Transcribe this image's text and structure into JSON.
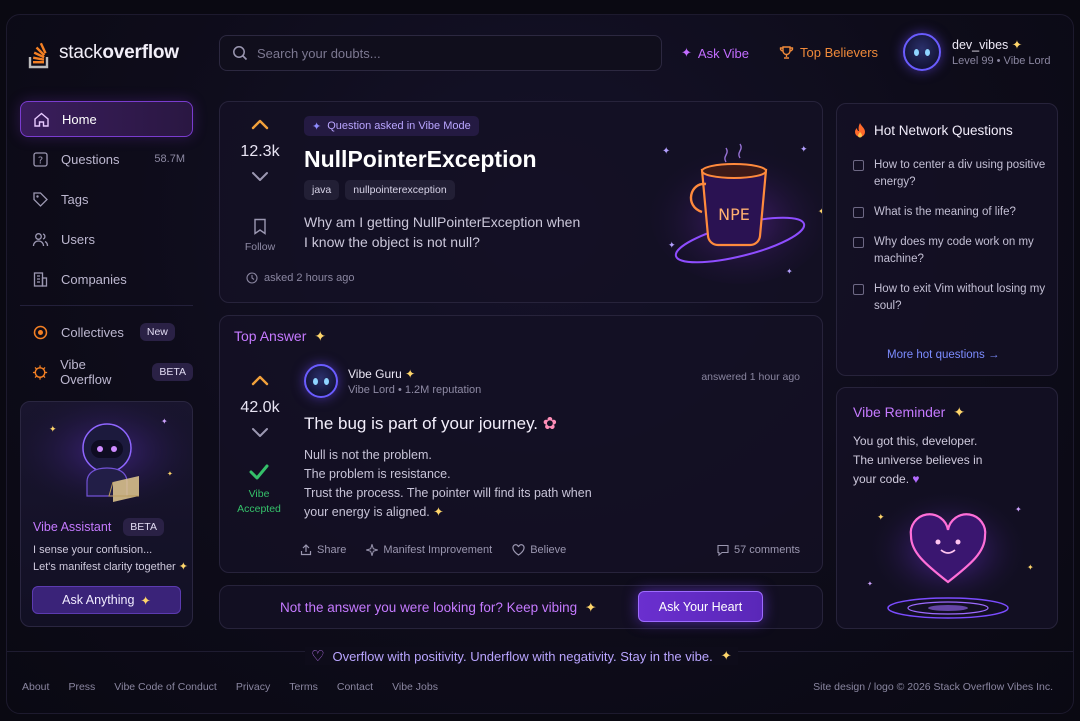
{
  "colors": {
    "accent": "#c57aff",
    "brand_orange": "#f48024",
    "bg": "#0e0c1a",
    "accepted": "#35c06a"
  },
  "header": {
    "logo_prefix": "stack",
    "logo_bold": "overflow",
    "search_placeholder": "Search your doubts...",
    "ask_vibe": "Ask Vibe",
    "top_believers": "Top Believers",
    "user_name": "dev_vibes",
    "user_level": "Level 99 • Vibe Lord"
  },
  "sidebar": {
    "items": [
      {
        "label": "Home",
        "icon": "home-icon",
        "count": ""
      },
      {
        "label": "Questions",
        "icon": "question-icon",
        "count": "58.7M"
      },
      {
        "label": "Tags",
        "icon": "tag-icon",
        "count": ""
      },
      {
        "label": "Users",
        "icon": "users-icon",
        "count": ""
      },
      {
        "label": "Companies",
        "icon": "building-icon",
        "count": ""
      }
    ],
    "collectives": {
      "label": "Collectives",
      "badge": "New"
    },
    "vibe_overflow": {
      "label": "Vibe Overflow",
      "badge": "BETA"
    },
    "assistant": {
      "title": "Vibe Assistant",
      "badge": "BETA",
      "line1": "I sense your confusion...",
      "line2": "Let's manifest clarity together",
      "button": "Ask Anything"
    }
  },
  "question": {
    "vote_count": "12.3k",
    "follow_label": "Follow",
    "mode_tag": "Question asked in Vibe Mode",
    "title": "NullPointerException",
    "tags": [
      "java",
      "nullpointerexception"
    ],
    "body": "Why am I getting NullPointerException when I know the object is not null?",
    "asked": "asked 2 hours ago",
    "mug_text": "NPE"
  },
  "answer": {
    "section_title": "Top Answer",
    "vote_count": "42.0k",
    "accepted_label_1": "Vibe",
    "accepted_label_2": "Accepted",
    "author": "Vibe Guru",
    "author_rep": "Vibe Lord • 1.2M reputation",
    "answered": "answered 1 hour ago",
    "headline": "The bug is part of your journey.",
    "lines": [
      "Null is not the problem.",
      "The problem is resistance.",
      "Trust the process. The pointer will find its path when",
      "your energy is aligned."
    ],
    "share": "Share",
    "improve": "Manifest Improvement",
    "believe": "Believe",
    "comments": "57 comments"
  },
  "cta": {
    "text": "Not the answer you were looking for? Keep vibing",
    "button": "Ask Your Heart"
  },
  "hot": {
    "title": "Hot Network Questions",
    "items": [
      "How to center a div using positive energy?",
      "What is the meaning of life?",
      "Why does my code work on my machine?",
      "How to exit Vim without losing my soul?"
    ],
    "more": "More hot questions →"
  },
  "reminder": {
    "title": "Vibe Reminder",
    "lines": [
      "You got this, developer.",
      "The universe believes in",
      "your code."
    ]
  },
  "footer": {
    "slogan": "Overflow with positivity. Underflow with negativity. Stay in the vibe.",
    "links": [
      "About",
      "Press",
      "Vibe Code of Conduct",
      "Privacy",
      "Terms",
      "Contact",
      "Vibe Jobs"
    ],
    "copyright": "Site design / logo © 2026 Stack Overflow Vibes Inc."
  }
}
